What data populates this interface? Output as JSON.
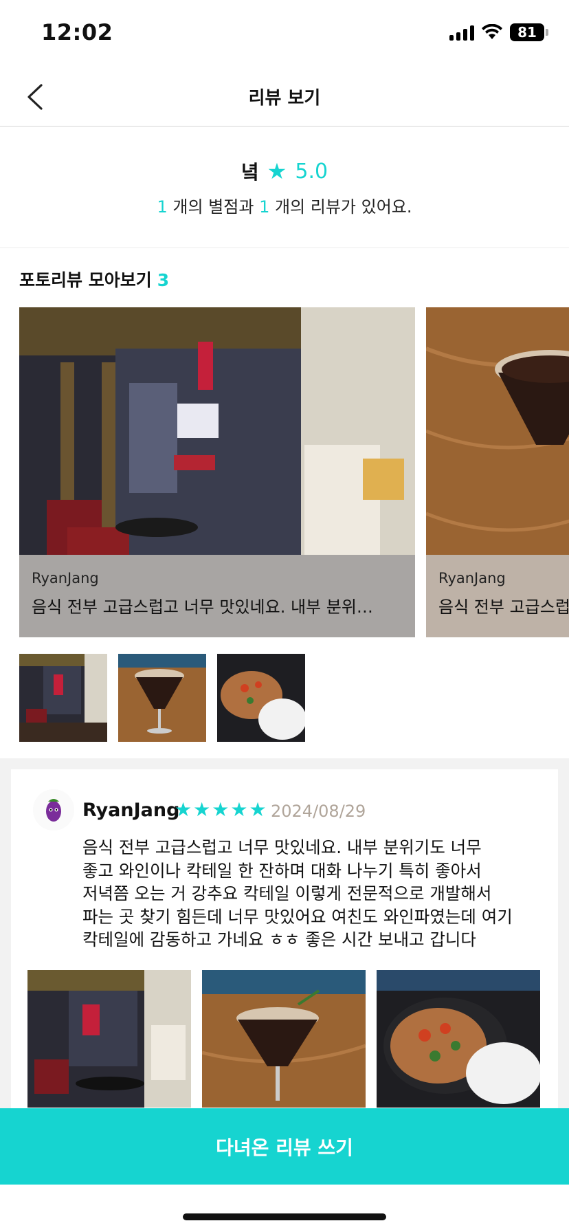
{
  "status_bar": {
    "time": "12:02",
    "battery": "81"
  },
  "header": {
    "title": "리뷰 보기"
  },
  "summary": {
    "place_name": "녘",
    "rating": "5.0",
    "count_rating": "1",
    "count_rating_suffix": " 개의 별점과 ",
    "count_review": "1",
    "count_review_suffix": " 개의 리뷰가 있어요."
  },
  "photo_reviews": {
    "title": "포토리뷰 모아보기",
    "count": "3",
    "slides": [
      {
        "author": "RyanJang",
        "text": "음식 전부 고급스럽고 너무 맛있네요. 내부 분위…"
      },
      {
        "author": "RyanJang",
        "text": "음식 전부 고급스럽"
      }
    ]
  },
  "review": {
    "author": "RyanJang",
    "date": "2024/08/29",
    "rating": 5,
    "text_lines": [
      "음식 전부 고급스럽고 너무 맛있네요. 내부 분위기도 너무",
      "좋고 와인이나 칵테일 한 잔하며 대화 나누기 특히 좋아서",
      "저녁쯤 오는 거 강추요 칵테일 이렇게 전문적으로 개발해서",
      "파는 곳 찾기 힘든데 너무 맛있어요 여친도 와인파였는데 여기",
      "칵테일에 감동하고 가네요 ㅎㅎ 좋은 시간 보내고 갑니다"
    ]
  },
  "cta": {
    "label": "다녀온 리뷰 쓰기"
  },
  "colors": {
    "accent": "#16d4d0",
    "date": "#b0a59a"
  }
}
